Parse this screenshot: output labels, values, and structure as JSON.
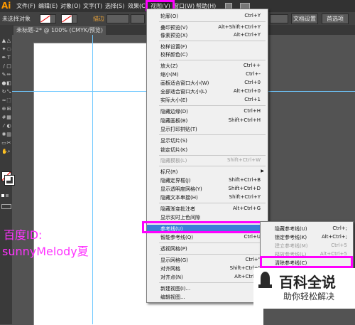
{
  "app": {
    "logo": "Ai"
  },
  "menubar": {
    "items": [
      "文件(F)",
      "编辑(E)",
      "对象(O)",
      "文字(T)",
      "选择(S)",
      "效果(C)",
      "视图(V)",
      "窗口(W)",
      "帮助(H)"
    ],
    "active": "视图(V)"
  },
  "control_bar": {
    "selection_status": "未选择对象",
    "stroke_label": "描边",
    "doc_setup_button": "文档设置",
    "prefs_button": "首选项"
  },
  "tab": {
    "title": "未标题-2* @ 100% (CMYK/预览)"
  },
  "view_menu": {
    "items": [
      {
        "label": "轮廓(O)",
        "shortcut": "Ctrl+Y"
      },
      {
        "label": "叠印预览(V)",
        "shortcut": "Alt+Shift+Ctrl+Y"
      },
      {
        "label": "像素预览(X)",
        "shortcut": "Alt+Ctrl+Y"
      },
      {
        "label": "校样设置(F)",
        "shortcut": ""
      },
      {
        "label": "校样颜色(C)",
        "shortcut": ""
      },
      {
        "label": "放大(Z)",
        "shortcut": "Ctrl++"
      },
      {
        "label": "缩小(M)",
        "shortcut": "Ctrl+-"
      },
      {
        "label": "画板适合窗口大小(W)",
        "shortcut": "Ctrl+0"
      },
      {
        "label": "全部适合窗口大小(L)",
        "shortcut": "Alt+Ctrl+0"
      },
      {
        "label": "实际大小(E)",
        "shortcut": "Ctrl+1"
      },
      {
        "label": "隐藏边缘(D)",
        "shortcut": "Ctrl+H"
      },
      {
        "label": "隐藏画板(B)",
        "shortcut": "Shift+Ctrl+H"
      },
      {
        "label": "显示打印拼贴(T)",
        "shortcut": ""
      },
      {
        "label": "显示切片(S)",
        "shortcut": ""
      },
      {
        "label": "锁定切片(K)",
        "shortcut": ""
      },
      {
        "label": "隐藏模板(L)",
        "shortcut": "Shift+Ctrl+W",
        "disabled": true
      },
      {
        "label": "标尺(R)",
        "shortcut": ""
      },
      {
        "label": "隐藏定界框(J)",
        "shortcut": "Shift+Ctrl+B"
      },
      {
        "label": "显示透明度网格(Y)",
        "shortcut": "Shift+Ctrl+D"
      },
      {
        "label": "隐藏文本串接(H)",
        "shortcut": "Shift+Ctrl+Y"
      },
      {
        "label": "隐藏渐变批注者",
        "shortcut": "Alt+Ctrl+G"
      },
      {
        "label": "显示实时上色间隙",
        "shortcut": ""
      },
      {
        "label": "参考线(U)",
        "shortcut": ""
      },
      {
        "label": "智能参考线(Q)",
        "shortcut": "Ctrl+U"
      },
      {
        "label": "透视网格(P)",
        "shortcut": ""
      },
      {
        "label": "显示网格(G)",
        "shortcut": "Ctrl+\""
      },
      {
        "label": "对齐网格",
        "shortcut": "Shift+Ctrl+\""
      },
      {
        "label": "对齐点(N)",
        "shortcut": "Alt+Ctrl+\""
      },
      {
        "label": "新建视图(I)...",
        "shortcut": ""
      },
      {
        "label": "编辑视图...",
        "shortcut": ""
      }
    ]
  },
  "guides_submenu": {
    "items": [
      {
        "label": "隐藏参考线(U)",
        "shortcut": "Ctrl+;"
      },
      {
        "label": "锁定参考线(K)",
        "shortcut": "Alt+Ctrl+;"
      },
      {
        "label": "建立参考线(M)",
        "shortcut": "Ctrl+5",
        "disabled": true
      },
      {
        "label": "释放参考线(L)",
        "shortcut": "Alt+Ctrl+5",
        "disabled": true
      },
      {
        "label": "清除参考线(C)",
        "shortcut": ""
      }
    ]
  },
  "watermark": {
    "line1": "百度ID:",
    "line2": "sunnyMelody夏",
    "logo_title": "百科全说",
    "logo_sub": "助你轻松解决"
  },
  "colors": {
    "highlight": "#ff00ff",
    "menu_selected": "#3c7fd8",
    "guide": "#6ec8ff"
  }
}
